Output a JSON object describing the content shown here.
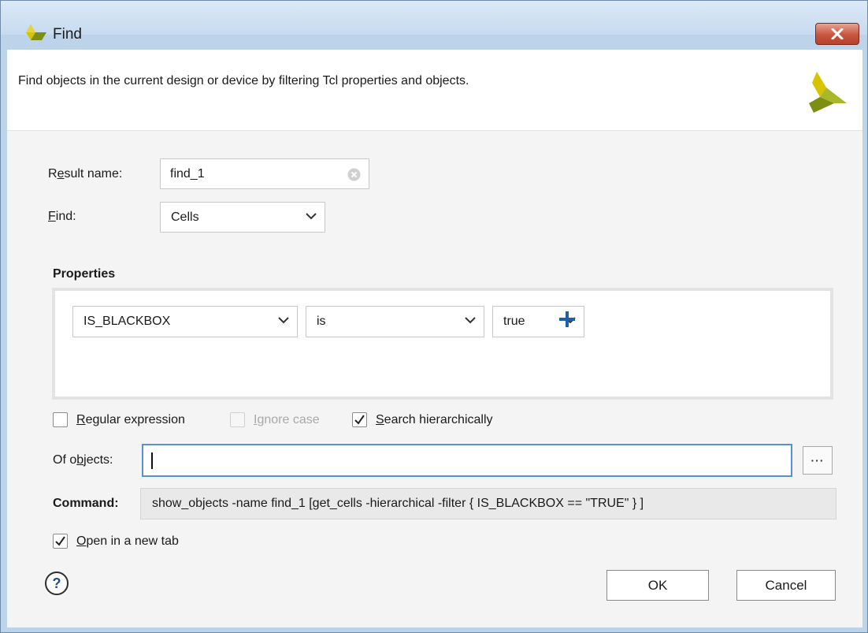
{
  "window": {
    "title": "Find"
  },
  "banner": {
    "description": "Find objects in the current design or device by filtering Tcl properties and objects."
  },
  "result_name": {
    "label_prefix": "R",
    "label_mnemonic": "e",
    "label_suffix": "sult name:",
    "value": "find_1"
  },
  "find": {
    "label_mnemonic": "F",
    "label_suffix": "ind:",
    "selected": "Cells"
  },
  "properties": {
    "heading": "Properties",
    "filter": {
      "property": "IS_BLACKBOX",
      "operator": "is",
      "value": "true"
    }
  },
  "options": {
    "regular_expression": {
      "mnemonic": "R",
      "rest": "egular expression",
      "checked": false,
      "enabled": true
    },
    "ignore_case": {
      "mnemonic": "I",
      "rest": "gnore case",
      "checked": false,
      "enabled": false
    },
    "search_hierarchically": {
      "mnemonic": "S",
      "rest": "earch hierarchically",
      "checked": true,
      "enabled": true
    }
  },
  "of_objects": {
    "label_prefix": "Of o",
    "label_mnemonic": "b",
    "label_suffix": "jects:",
    "value": "",
    "browse_label": "···"
  },
  "command": {
    "label": "Command:",
    "text": "show_objects -name find_1 [get_cells -hierarchical -filter { IS_BLACKBOX == \"TRUE\" } ]"
  },
  "open_in_new_tab": {
    "mnemonic": "O",
    "rest": "pen in a new tab",
    "checked": true
  },
  "buttons": {
    "help": "?",
    "ok": "OK",
    "cancel": "Cancel"
  },
  "colors": {
    "accent_blue": "#1f5ea8",
    "logo_yellow": "#d6c400",
    "logo_green": "#7d8f12",
    "focus_border": "#5a8fd6",
    "close_red": "#c7553d"
  },
  "icons": {
    "app": "xilinx-logo-icon",
    "close": "close-icon",
    "clear": "clear-icon",
    "dropdown": "chevron-down-icon",
    "add": "plus-icon",
    "help": "help-icon",
    "check": "checkmark-icon"
  }
}
